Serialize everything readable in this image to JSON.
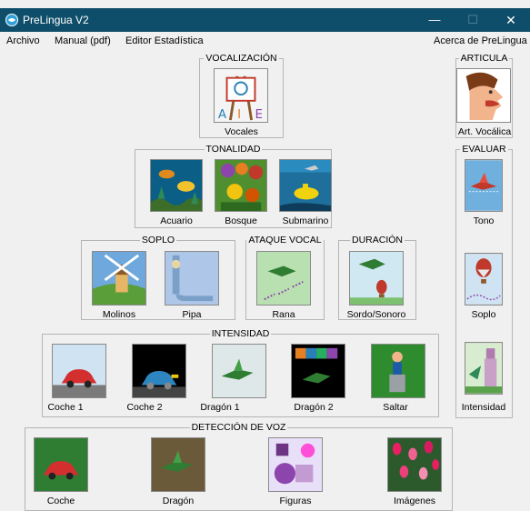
{
  "window": {
    "title": "PreLingua V2",
    "minimize": "—",
    "maximize": "☐",
    "close": "✕"
  },
  "menu": {
    "archivo": "Archivo",
    "manual": "Manual (pdf)",
    "editor": "Editor Estadística",
    "acerca": "Acerca de PreLingua"
  },
  "vocalizacion": {
    "title": "VOCALIZACIÓN",
    "vocales": "Vocales"
  },
  "articula": {
    "title": "ARTICULA",
    "art_vocalica": "Art. Vocálica"
  },
  "tonalidad": {
    "title": "TONALIDAD",
    "acuario": "Acuario",
    "bosque": "Bosque",
    "submarino": "Submarino"
  },
  "evaluar": {
    "title": "EVALUAR",
    "tono": "Tono",
    "soplo": "Soplo",
    "intensidad": "Intensidad"
  },
  "soplo": {
    "title": "SOPLO",
    "molinos": "Molinos",
    "pipa": "Pipa"
  },
  "ataque_vocal": {
    "title": "ATAQUE VOCAL",
    "rana": "Rana"
  },
  "duracion": {
    "title": "DURACIÓN",
    "sordo_sonoro": "Sordo/Sonoro"
  },
  "intensidad": {
    "title": "INTENSIDAD",
    "coche1": "Coche 1",
    "coche2": "Coche 2",
    "dragon1": "Dragón 1",
    "dragon2": "Dragón 2",
    "saltar": "Saltar"
  },
  "deteccion": {
    "title": "DETECCIÓN DE VOZ",
    "coche": "Coche",
    "dragon": "Dragón",
    "figuras": "Figuras",
    "imagenes": "Imágenes"
  },
  "icons": {
    "app": "app-globe-icon",
    "vocales": "easel-letters-icon",
    "art_vocalica": "head-profile-icon",
    "acuario": "aquarium-icon",
    "bosque": "forest-icon",
    "submarino": "submarine-icon",
    "tono": "dragon-flying-icon",
    "soplo_eval": "balloon-icon",
    "intensidad_eval": "castle-icon",
    "molinos": "windmill-icon",
    "pipa": "pipe-icon",
    "rana": "frog-icon",
    "sordo_sonoro": "dragon-balloon-icon",
    "coche1": "red-car-icon",
    "coche2": "blue-car-icon",
    "dragon1": "green-dragon-icon",
    "dragon2": "dragon-blocks-icon",
    "saltar": "jumping-character-icon",
    "coche": "red-car-icon",
    "dragon": "dragon-icon",
    "figuras": "shapes-icon",
    "imagenes": "tulips-icon"
  },
  "colors": {
    "titlebar": "#0f4e6a",
    "background": "#f0f0f0",
    "group_border": "#b5b5b5"
  }
}
